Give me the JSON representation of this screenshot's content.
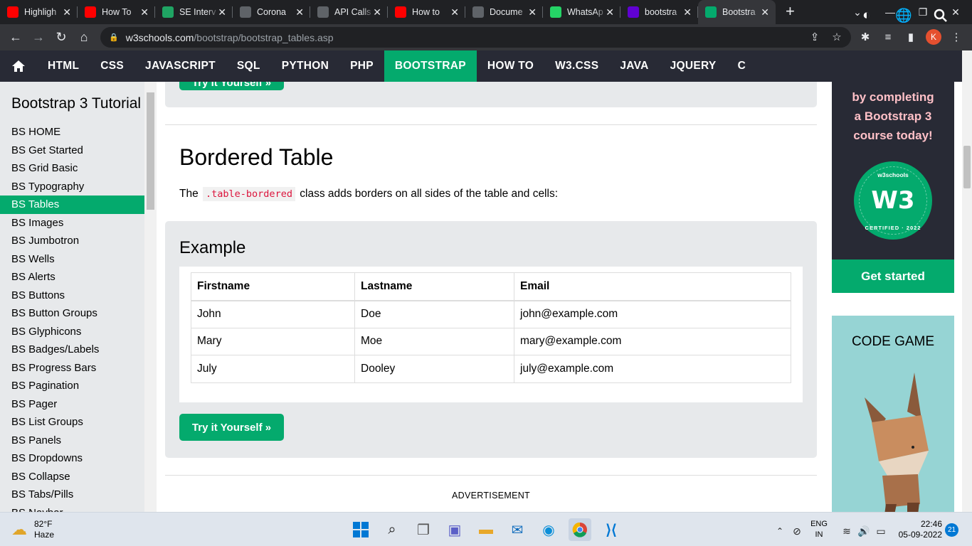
{
  "browser": {
    "tabs": [
      {
        "title": "Highligh",
        "favicon": "youtube-icon",
        "color": "#ff0000"
      },
      {
        "title": "How To",
        "favicon": "youtube-icon",
        "color": "#ff0000"
      },
      {
        "title": "SE Interv",
        "favicon": "google-drive-icon",
        "color": "#1fa463"
      },
      {
        "title": "Corona",
        "favicon": "octopus-icon",
        "color": "#5f6368"
      },
      {
        "title": "API Calls",
        "favicon": "globe-icon",
        "color": "#5f6368"
      },
      {
        "title": "How to",
        "favicon": "youtube-icon",
        "color": "#ff0000"
      },
      {
        "title": "Docume",
        "favicon": "globe-icon",
        "color": "#5f6368"
      },
      {
        "title": "WhatsAp",
        "favicon": "whatsapp-icon",
        "color": "#25d366"
      },
      {
        "title": "bootstra",
        "favicon": "yahoo-icon",
        "color": "#6001d2"
      },
      {
        "title": "Bootstra",
        "favicon": "w3schools-icon",
        "color": "#04aa6d"
      }
    ],
    "url_host": "w3schools.com",
    "url_path": "/bootstrap/bootstrap_tables.asp",
    "profile_initial": "K"
  },
  "w3nav": {
    "items": [
      "HTML",
      "CSS",
      "JAVASCRIPT",
      "SQL",
      "PYTHON",
      "PHP",
      "BOOTSTRAP",
      "HOW TO",
      "W3.CSS",
      "JAVA",
      "JQUERY",
      "C"
    ],
    "active": "BOOTSTRAP"
  },
  "sidebar": {
    "title": "Bootstrap 3 Tutorial",
    "items": [
      "BS HOME",
      "BS Get Started",
      "BS Grid Basic",
      "BS Typography",
      "BS Tables",
      "BS Images",
      "BS Jumbotron",
      "BS Wells",
      "BS Alerts",
      "BS Buttons",
      "BS Button Groups",
      "BS Glyphicons",
      "BS Badges/Labels",
      "BS Progress Bars",
      "BS Pagination",
      "BS Pager",
      "BS List Groups",
      "BS Panels",
      "BS Dropdowns",
      "BS Collapse",
      "BS Tabs/Pills",
      "BS Navbar"
    ],
    "active": "BS Tables"
  },
  "main": {
    "heading": "Bordered Table",
    "intro_before": "The",
    "intro_code": ".table-bordered",
    "intro_after": "class adds borders on all sides of the table and cells:",
    "example_heading": "Example",
    "table": {
      "headers": [
        "Firstname",
        "Lastname",
        "Email"
      ],
      "rows": [
        [
          "John",
          "Doe",
          "john@example.com"
        ],
        [
          "Mary",
          "Moe",
          "mary@example.com"
        ],
        [
          "July",
          "Dooley",
          "july@example.com"
        ]
      ]
    },
    "try_button": "Try it Yourself »",
    "advertisement": "ADVERTISEMENT"
  },
  "right_ad": {
    "promo_lines": [
      "by completing",
      "a Bootstrap 3",
      "course today!"
    ],
    "badge_top": "w3schools",
    "badge_bottom": "CERTIFIED · 2022",
    "badge_logo": "W3",
    "cta": "Get started",
    "code_game": "CODE GAME"
  },
  "taskbar": {
    "weather_temp": "82°F",
    "weather_desc": "Haze",
    "lang_1": "ENG",
    "lang_2": "IN",
    "time": "22:46",
    "date": "05-09-2022",
    "notifications": "21"
  }
}
